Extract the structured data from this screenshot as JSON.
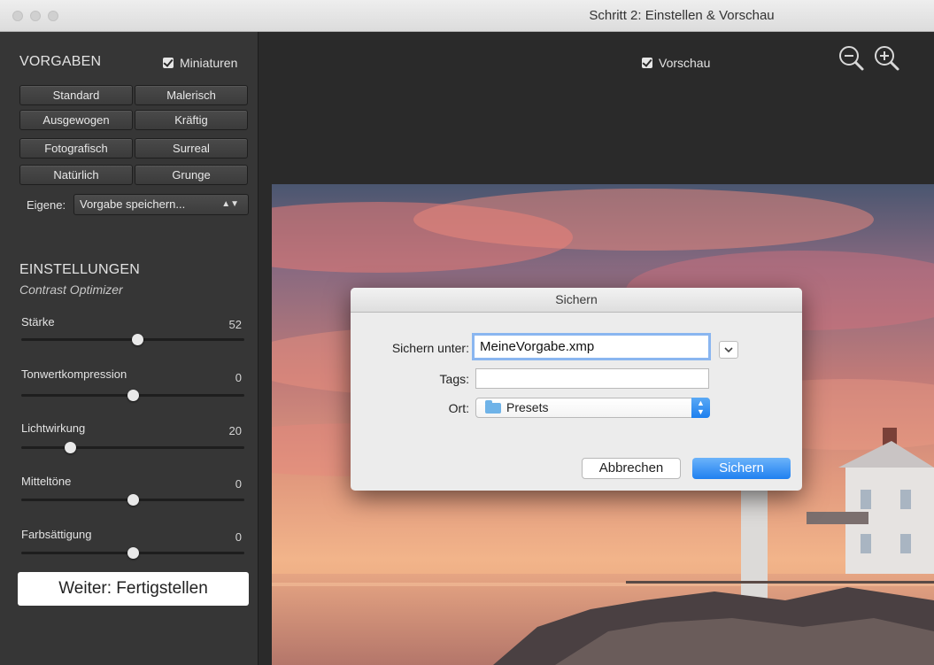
{
  "window": {
    "title": "Schritt 2: Einstellen & Vorschau"
  },
  "presets": {
    "heading": "VORGABEN",
    "thumbnails_label": "Miniaturen",
    "thumbnails_checked": true,
    "buttons": [
      "Standard",
      "Malerisch",
      "Ausgewogen",
      "Kräftig",
      "Fotografisch",
      "Surreal",
      "Natürlich",
      "Grunge"
    ],
    "custom_label": "Eigene:",
    "custom_value": "Vorgabe speichern..."
  },
  "settings": {
    "heading": "EINSTELLUNGEN",
    "subtitle": "Contrast Optimizer",
    "sliders": [
      {
        "label": "Stärke",
        "value": "52",
        "fraction": 0.52
      },
      {
        "label": "Tonwertkompression",
        "value": "0",
        "fraction": 0.5
      },
      {
        "label": "Lichtwirkung",
        "value": "20",
        "fraction": 0.22
      },
      {
        "label": "Mitteltöne",
        "value": "0",
        "fraction": 0.5
      },
      {
        "label": "Farbsättigung",
        "value": "0",
        "fraction": 0.5
      }
    ]
  },
  "next_button": "Weiter: Fertigstellen",
  "preview": {
    "label": "Vorschau",
    "checked": true,
    "zoom_out": "zoom-out-icon",
    "zoom_in": "zoom-in-icon"
  },
  "save_dialog": {
    "title": "Sichern",
    "save_as_label": "Sichern unter:",
    "save_as_value": "MeineVorgabe.xmp",
    "tags_label": "Tags:",
    "tags_value": "",
    "location_label": "Ort:",
    "location_value": "Presets",
    "cancel_label": "Abbrechen",
    "save_label": "Sichern"
  },
  "colors": {
    "sidebar_bg": "#363636",
    "main_bg": "#2a2a2a",
    "accent_blue": "#1f80f0"
  }
}
